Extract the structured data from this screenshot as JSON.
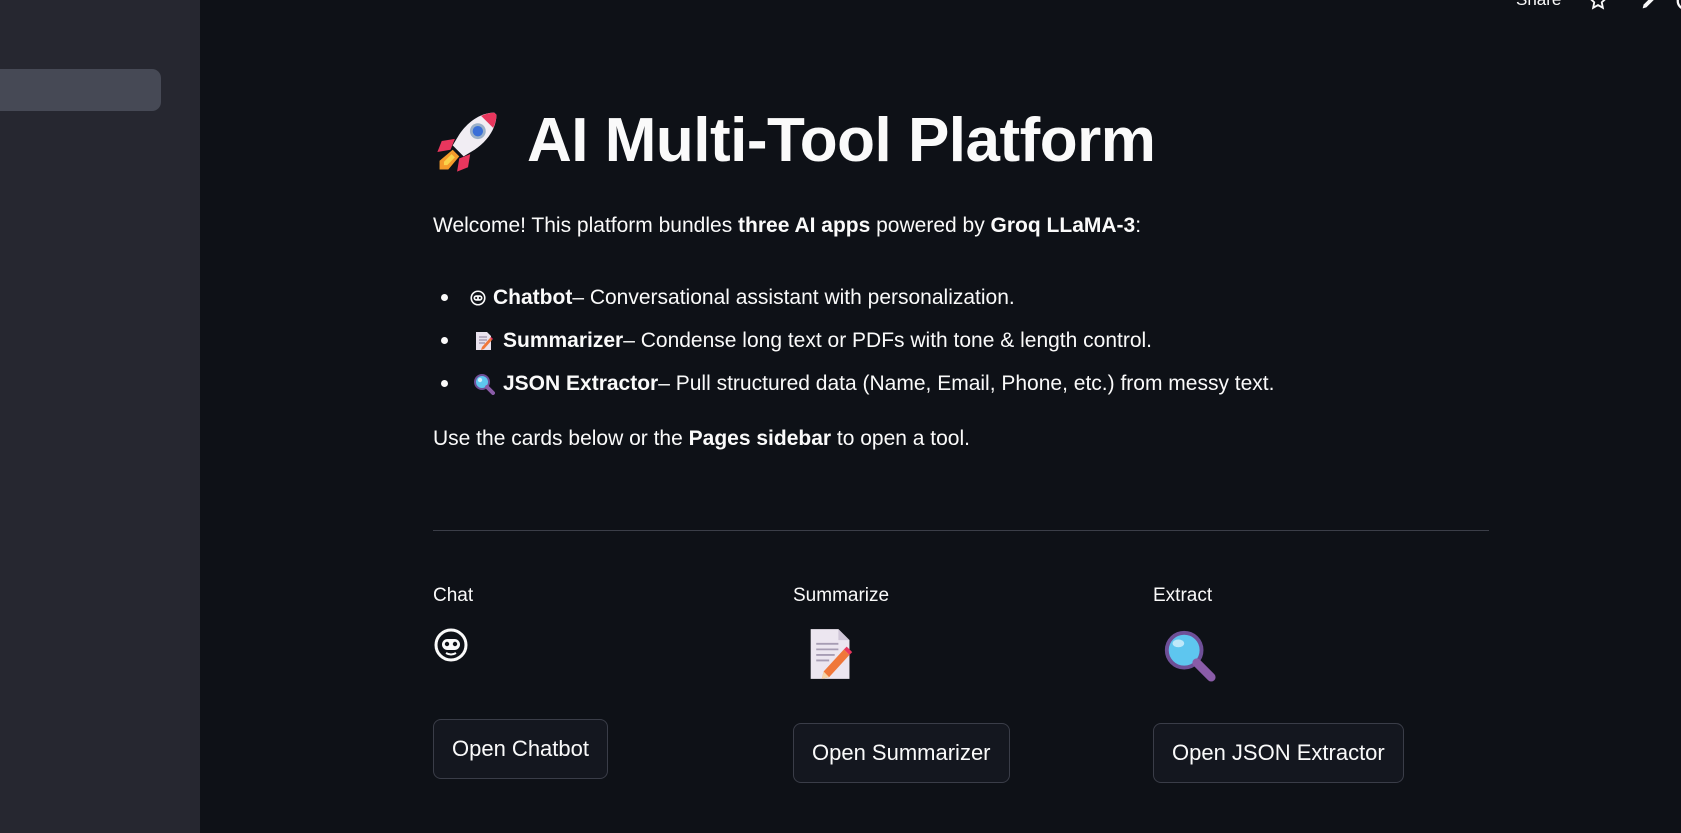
{
  "toolbar": {
    "share_label": "Share"
  },
  "main": {
    "title": "AI Multi-Tool Platform",
    "intro": {
      "prefix": "Welcome! This platform bundles ",
      "apps": "three AI apps",
      "middle": " powered by ",
      "model": "Groq LLaMA-3",
      "suffix": ":"
    },
    "features": [
      {
        "name": "Chatbot",
        "desc": " – Conversational assistant with personalization.",
        "icon": "robot-face-icon"
      },
      {
        "name": "Summarizer",
        "desc": " – Condense long text or PDFs with tone & length control.",
        "icon": "memo-icon"
      },
      {
        "name": "JSON Extractor",
        "desc": " – Pull structured data (Name, Email, Phone, etc.) from messy text.",
        "icon": "magnifier-icon"
      }
    ],
    "outro": {
      "prefix": "Use the cards below or the ",
      "emph": "Pages sidebar",
      "suffix": " to open a tool."
    }
  },
  "cards": [
    {
      "label": "Chat",
      "button": "Open Chatbot",
      "icon": "robot-face-icon"
    },
    {
      "label": "Summarize",
      "button": "Open Summarizer",
      "icon": "memo-icon"
    },
    {
      "label": "Extract",
      "button": "Open JSON Extractor",
      "icon": "magnifier-icon"
    }
  ],
  "colors": {
    "background": "#0e1117",
    "sidebar": "#262730",
    "text": "#fafafa",
    "button_border": "#3a3d48"
  }
}
